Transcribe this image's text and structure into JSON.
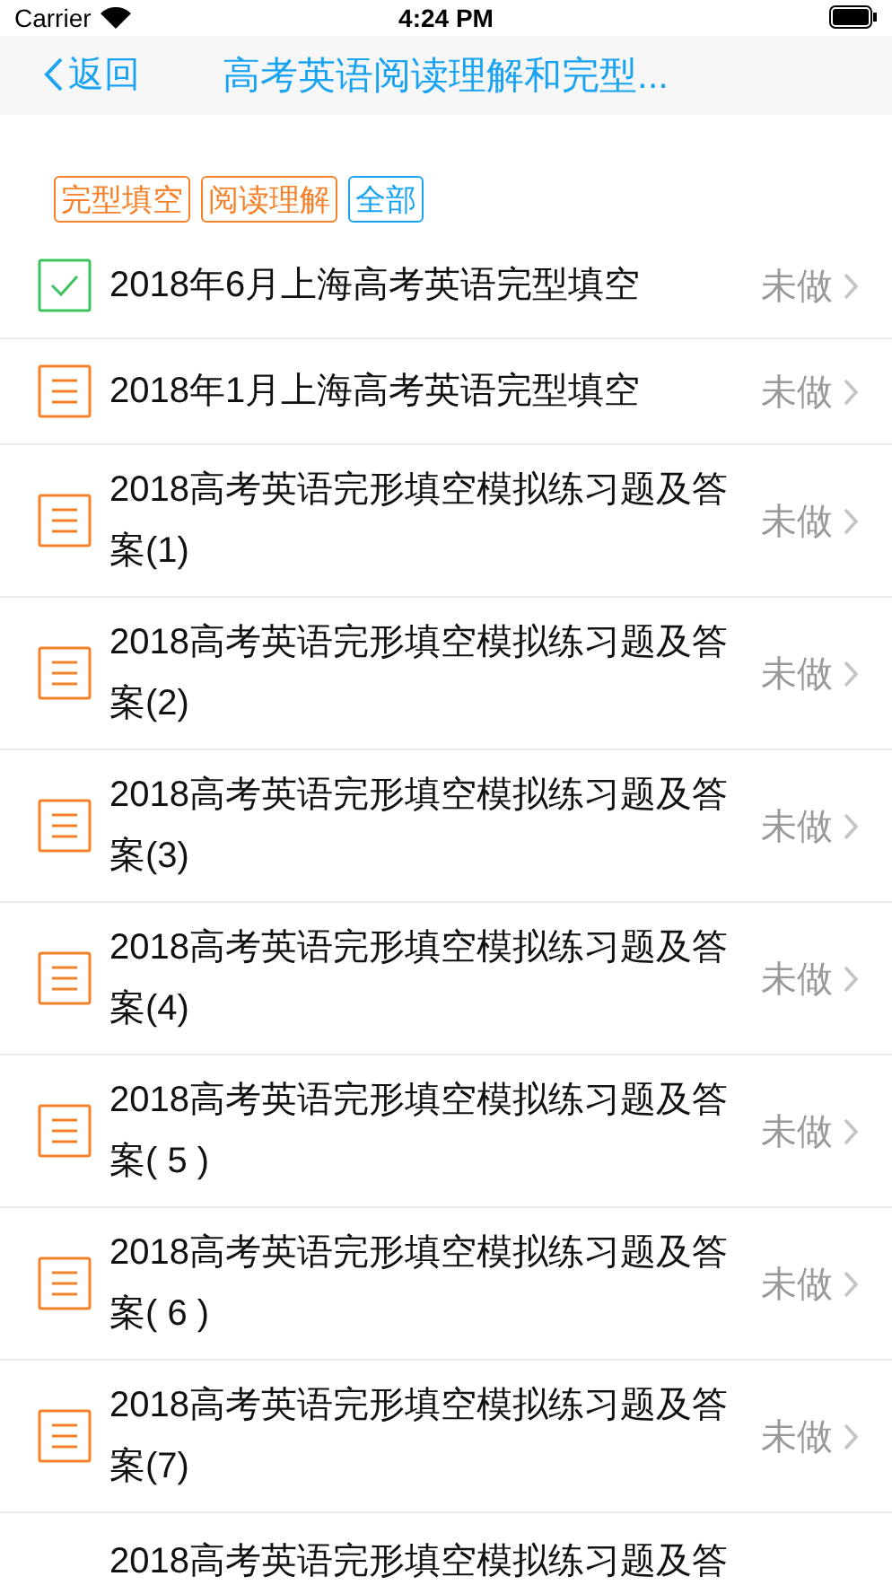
{
  "status_bar": {
    "carrier": "Carrier",
    "time": "4:24 PM"
  },
  "nav": {
    "back": "返回",
    "title": "高考英语阅读理解和完型..."
  },
  "filters": [
    {
      "label": "完型填空",
      "color": "#f5822a"
    },
    {
      "label": "阅读理解",
      "color": "#f5822a"
    },
    {
      "label": "全部",
      "color": "#1aa3f0"
    }
  ],
  "items": [
    {
      "kind": "done",
      "title": "2018年6月上海高考英语完型填空",
      "status": "未做"
    },
    {
      "kind": "todo",
      "title": "2018年1月上海高考英语完型填空",
      "status": "未做"
    },
    {
      "kind": "todo",
      "title": "2018高考英语完形填空模拟练习题及答案(1)",
      "status": "未做"
    },
    {
      "kind": "todo",
      "title": "2018高考英语完形填空模拟练习题及答案(2)",
      "status": "未做"
    },
    {
      "kind": "todo",
      "title": "2018高考英语完形填空模拟练习题及答案(3)",
      "status": "未做"
    },
    {
      "kind": "todo",
      "title": "2018高考英语完形填空模拟练习题及答案(4)",
      "status": "未做"
    },
    {
      "kind": "todo",
      "title": "2018高考英语完形填空模拟练习题及答案( 5 )",
      "status": "未做"
    },
    {
      "kind": "todo",
      "title": "2018高考英语完形填空模拟练习题及答案( 6 )",
      "status": "未做"
    },
    {
      "kind": "todo",
      "title": "2018高考英语完形填空模拟练习题及答案(7)",
      "status": "未做"
    },
    {
      "kind": "partial",
      "title": "2018高考英语完形填空模拟练习题及答"
    }
  ]
}
